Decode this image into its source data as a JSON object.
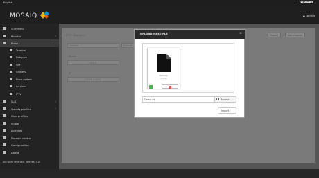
{
  "topbar": {
    "language": "English",
    "brand": "Televes"
  },
  "header": {
    "logo_text": "MOSAIQ",
    "user": "admin"
  },
  "sidebar": {
    "items": [
      {
        "label": "Summary"
      },
      {
        "label": "Monitor"
      },
      {
        "label": "Plans"
      },
      {
        "label": "Terminal"
      },
      {
        "label": "Dataplan"
      },
      {
        "label": "SIM"
      },
      {
        "label": "Clusters"
      },
      {
        "label": "Plans update"
      },
      {
        "label": "Ad plans"
      },
      {
        "label": "IPTV"
      },
      {
        "label": "SLB"
      },
      {
        "label": "Quality profiles"
      },
      {
        "label": "User profiles"
      },
      {
        "label": "Share"
      },
      {
        "label": "Licenses"
      },
      {
        "label": "Domain control"
      },
      {
        "label": "Configuration"
      },
      {
        "label": "About"
      }
    ],
    "copyright": "All rights reserved. Televes, S.A."
  },
  "main": {
    "page_title": "IPTV (Demo01)",
    "import_label": "Import",
    "add_label": "Add channel",
    "col1": "Default",
    "col2": "Channel",
    "cell1": "1.0.0.0",
    "cell2": "172.16.1.0/24",
    "label_a": "Name",
    "label_b": "IP"
  },
  "modal": {
    "title": "UPLOAD MULTIPLE",
    "close": "×",
    "file_name": "Demo.zip",
    "file_size": "(1.0 KB)",
    "path_value": "Demo.zip",
    "browse_label": "Browse ...",
    "import_label": "Import"
  },
  "colors": {
    "accent_green": "#4caf50",
    "delete_red": "#d9534f",
    "header_bg": "#1f1f1f"
  }
}
